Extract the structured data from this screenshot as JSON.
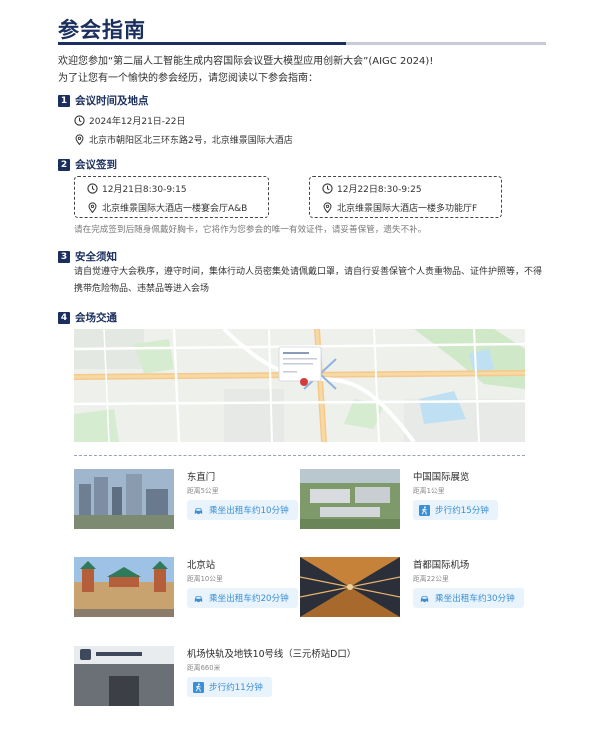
{
  "title": "参会指南",
  "intro": {
    "line1": "欢迎您参加“第二届人工智能生成内容国际会议暨大模型应用创新大会”(AIGC 2024)!",
    "line2": "为了让您有一个愉快的参会经历，请您阅读以下参会指南："
  },
  "sections": [
    {
      "num": "1",
      "title": "会议时间及地点"
    },
    {
      "num": "2",
      "title": "会议签到"
    },
    {
      "num": "3",
      "title": "安全须知"
    },
    {
      "num": "4",
      "title": "会场交通"
    }
  ],
  "time_place": {
    "date": "2024年12月21日-22日",
    "address": "北京市朝阳区北三环东路2号，北京维景国际大酒店"
  },
  "checkin": [
    {
      "time": "12月21日8:30-9:15",
      "place": "北京维景国际大酒店一楼宴会厅A&B"
    },
    {
      "time": "12月22日8:30-9:25",
      "place": "北京维景国际大酒店一楼多功能厅F"
    }
  ],
  "checkin_note": "请在完成签到后随身佩戴好胸卡，它将作为您参会的唯一有效证件，请妥善保管，遗失不补。",
  "safety_text": "请自觉遵守大会秩序，遵守时间，集体行动人员密集处请佩戴口罩，请自行妥善保管个人贵重物品、证件护照等，不得携带危险物品、违禁品等进入会场",
  "transport": [
    {
      "name": "东直门",
      "distance": "距离5公里",
      "mode": "乘坐出租车约10分钟",
      "icon": "taxi-icon"
    },
    {
      "name": "中国国际展览",
      "distance": "距离1公里",
      "mode": "步行约15分钟",
      "icon": "walk-icon"
    },
    {
      "name": "北京站",
      "distance": "距离10公里",
      "mode": "乘坐出租车约20分钟",
      "icon": "taxi-icon"
    },
    {
      "name": "首都国际机场",
      "distance": "距离22公里",
      "mode": "乘坐出租车约30分钟",
      "icon": "taxi-icon"
    },
    {
      "name": "机场快轨及地铁10号线（三元桥站D口）",
      "distance": "距离660米",
      "mode": "步行约11分钟",
      "icon": "walk-icon"
    }
  ],
  "colors": {
    "navy": "#1b2f5e",
    "accent_blue": "#3b8fd4",
    "pill_bg": "#e8f3fb"
  }
}
